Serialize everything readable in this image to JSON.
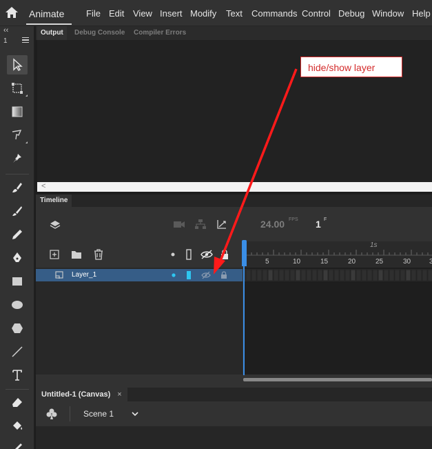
{
  "app": {
    "title": "Animate",
    "menu": [
      "File",
      "Edit",
      "View",
      "Insert",
      "Modify",
      "Text",
      "Commands",
      "Control",
      "Debug",
      "Window",
      "Help"
    ]
  },
  "toolbar": {
    "collapse_glyph": "‹‹",
    "count": "1",
    "tools": [
      "selection-tool",
      "free-transform-tool",
      "gradient-tool",
      "lasso-tool",
      "pin-tool",
      "paint-brush-tool",
      "brush-tool",
      "pencil-tool",
      "pen-tool",
      "rectangle-tool",
      "oval-tool",
      "polygon-tool",
      "line-tool",
      "text-tool",
      "eraser-tool",
      "paint-bucket-tool"
    ]
  },
  "output_panel": {
    "tabs": [
      "Output",
      "Debug Console",
      "Compiler Errors"
    ],
    "active_tab": "Output",
    "scroll_left_glyph": "<"
  },
  "timeline": {
    "tab_label": "Timeline",
    "fps": "24.00",
    "fps_unit": "FPS",
    "current_frame": "1",
    "frame_unit": "F",
    "ruler_marker": "1s",
    "frame_numbers": [
      "5",
      "10",
      "15",
      "20",
      "25",
      "30",
      "3"
    ],
    "layer_name": "Layer_1"
  },
  "document": {
    "tab_label": "Untitled-1 (Canvas)",
    "close_glyph": "×",
    "scene_label": "Scene 1"
  },
  "annotation": {
    "text": "hide/show layer",
    "color": "#d42a2a"
  },
  "colors": {
    "layer_highlight": "#365d87",
    "playhead": "#3a8ee6",
    "layer_color_swatch": "#2ec6f0"
  }
}
